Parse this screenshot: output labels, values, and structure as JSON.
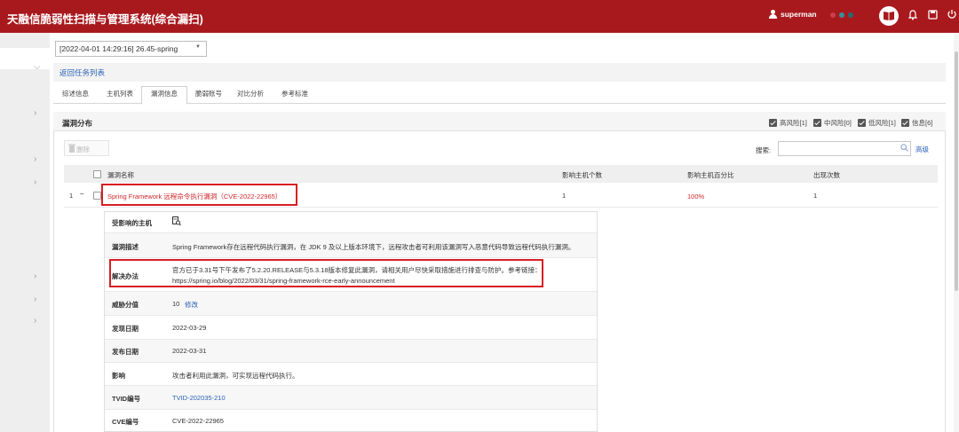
{
  "header": {
    "title": "天融信脆弱性扫描与管理系统(综合漏扫)",
    "username": "superman",
    "status_dots": [
      "#c94048",
      "#3a8f96",
      "#2b6a6f"
    ]
  },
  "task_selector": {
    "value": "[2022-04-01 14:29:16] 26.45-spring"
  },
  "back_link": "返回任务列表",
  "tabs": [
    "综述信息",
    "主机列表",
    "漏洞信息",
    "脆弱账号",
    "对比分析",
    "参考标准"
  ],
  "active_tab_index": 2,
  "panel": {
    "title": "漏洞分布",
    "legend": [
      {
        "label": "高风险[1]"
      },
      {
        "label": "中风险[0]"
      },
      {
        "label": "低风险[1]"
      },
      {
        "label": "信息[6]"
      }
    ],
    "delete_label": "删除",
    "search_label": "搜索:",
    "search_placeholder": "",
    "advanced_label": "高级"
  },
  "table": {
    "headers": [
      "漏洞名称",
      "影响主机个数",
      "影响主机百分比",
      "出现次数"
    ],
    "rows": [
      {
        "index": "1",
        "toggle": "−",
        "name": "Spring Framework 远程命令执行漏洞（CVE-2022-22965）",
        "hosts": "1",
        "percent": "100%",
        "count": "1"
      }
    ]
  },
  "detail": {
    "affected_hosts_label": "受影响的主机",
    "description_label": "漏洞描述",
    "description": "Spring Framework存在远程代码执行漏洞，在 JDK 9 及以上版本环境下，远程攻击者可利用该漏洞写入恶意代码导致远程代码执行漏洞。",
    "solution_label": "解决办法",
    "solution_line1": "官方已于3.31号下午发布了5.2.20.RELEASE与5.3.18版本修复此漏洞，请相关用户尽快采取措施进行排查与防护。参考链接：",
    "solution_line2": "https://spring.io/blog/2022/03/31/spring-framework-rce-early-announcement",
    "threat_label": "威胁分值",
    "threat_value": "10",
    "threat_edit": "修改",
    "discover_label": "发现日期",
    "discover_value": "2022-03-29",
    "publish_label": "发布日期",
    "publish_value": "2022-03-31",
    "impact_label": "影响",
    "impact_value": "攻击者利用此漏洞，可实现远程代码执行。",
    "tvid_label": "TVID编号",
    "tvid_value": "TVID-202035-210",
    "cve_label": "CVE编号",
    "cve_value": "CVE-2022-22965"
  }
}
